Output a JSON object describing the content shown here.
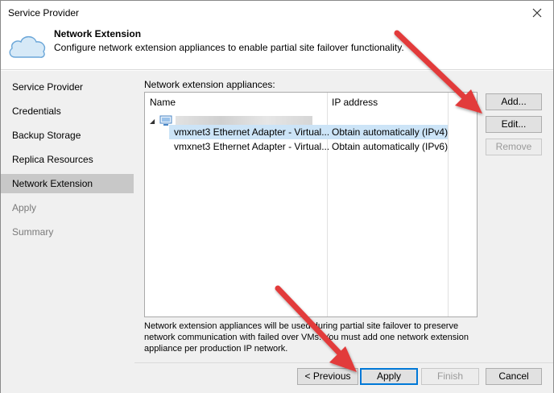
{
  "window": {
    "title": "Service Provider"
  },
  "header": {
    "title": "Network Extension",
    "subtitle": "Configure network extension appliances to enable partial site failover functionality."
  },
  "sidebar": {
    "items": [
      {
        "label": "Service Provider",
        "state": "normal"
      },
      {
        "label": "Credentials",
        "state": "normal"
      },
      {
        "label": "Backup Storage",
        "state": "normal"
      },
      {
        "label": "Replica Resources",
        "state": "normal"
      },
      {
        "label": "Network Extension",
        "state": "active"
      },
      {
        "label": "Apply",
        "state": "disabled"
      },
      {
        "label": "Summary",
        "state": "disabled"
      }
    ]
  },
  "appliances": {
    "label": "Network extension appliances:",
    "columns": {
      "name": "Name",
      "ip": "IP address"
    },
    "rows": [
      {
        "name": "vmxnet3 Ethernet Adapter - Virtual...",
        "ip": "Obtain automatically (IPv4)",
        "selected": true
      },
      {
        "name": "vmxnet3 Ethernet Adapter - Virtual...",
        "ip": "Obtain automatically (IPv6)",
        "selected": false
      }
    ]
  },
  "side_buttons": {
    "add": "Add...",
    "edit": "Edit...",
    "remove": "Remove"
  },
  "note": "Network extension appliances will be used during partial site failover to preserve network communication with failed over VMs. You must add one network extension appliance per production IP network.",
  "footer": {
    "previous": "< Previous",
    "apply": "Apply",
    "finish": "Finish",
    "cancel": "Cancel"
  },
  "colors": {
    "accent": "#0078d7",
    "selection": "#cce4f7",
    "arrow": "#e23b3b"
  }
}
